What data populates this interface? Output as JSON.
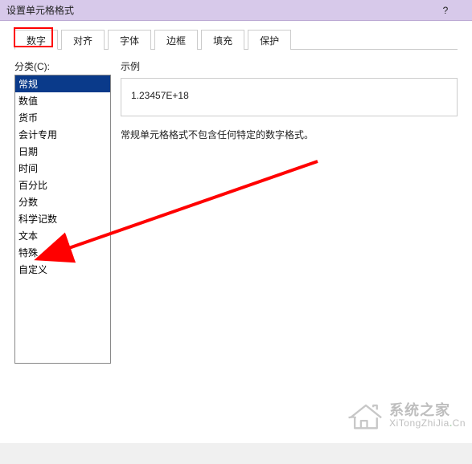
{
  "title": "设置单元格格式",
  "help": "?",
  "tabs": [
    {
      "label": "数字",
      "active": true
    },
    {
      "label": "对齐",
      "active": false
    },
    {
      "label": "字体",
      "active": false
    },
    {
      "label": "边框",
      "active": false
    },
    {
      "label": "填充",
      "active": false
    },
    {
      "label": "保护",
      "active": false
    }
  ],
  "category_label": "分类(C):",
  "categories": [
    {
      "label": "常规",
      "selected": true
    },
    {
      "label": "数值",
      "selected": false
    },
    {
      "label": "货币",
      "selected": false
    },
    {
      "label": "会计专用",
      "selected": false
    },
    {
      "label": "日期",
      "selected": false
    },
    {
      "label": "时间",
      "selected": false
    },
    {
      "label": "百分比",
      "selected": false
    },
    {
      "label": "分数",
      "selected": false
    },
    {
      "label": "科学记数",
      "selected": false
    },
    {
      "label": "文本",
      "selected": false
    },
    {
      "label": "特殊",
      "selected": false
    },
    {
      "label": "自定义",
      "selected": false
    }
  ],
  "preview_label": "示例",
  "preview_value": "1.23457E+18",
  "description": "常规单元格格式不包含任何特定的数字格式。",
  "watermark": {
    "line1": "系统之家",
    "line2_a": "XiTongZhiJia",
    "line2_b": "Cn"
  }
}
